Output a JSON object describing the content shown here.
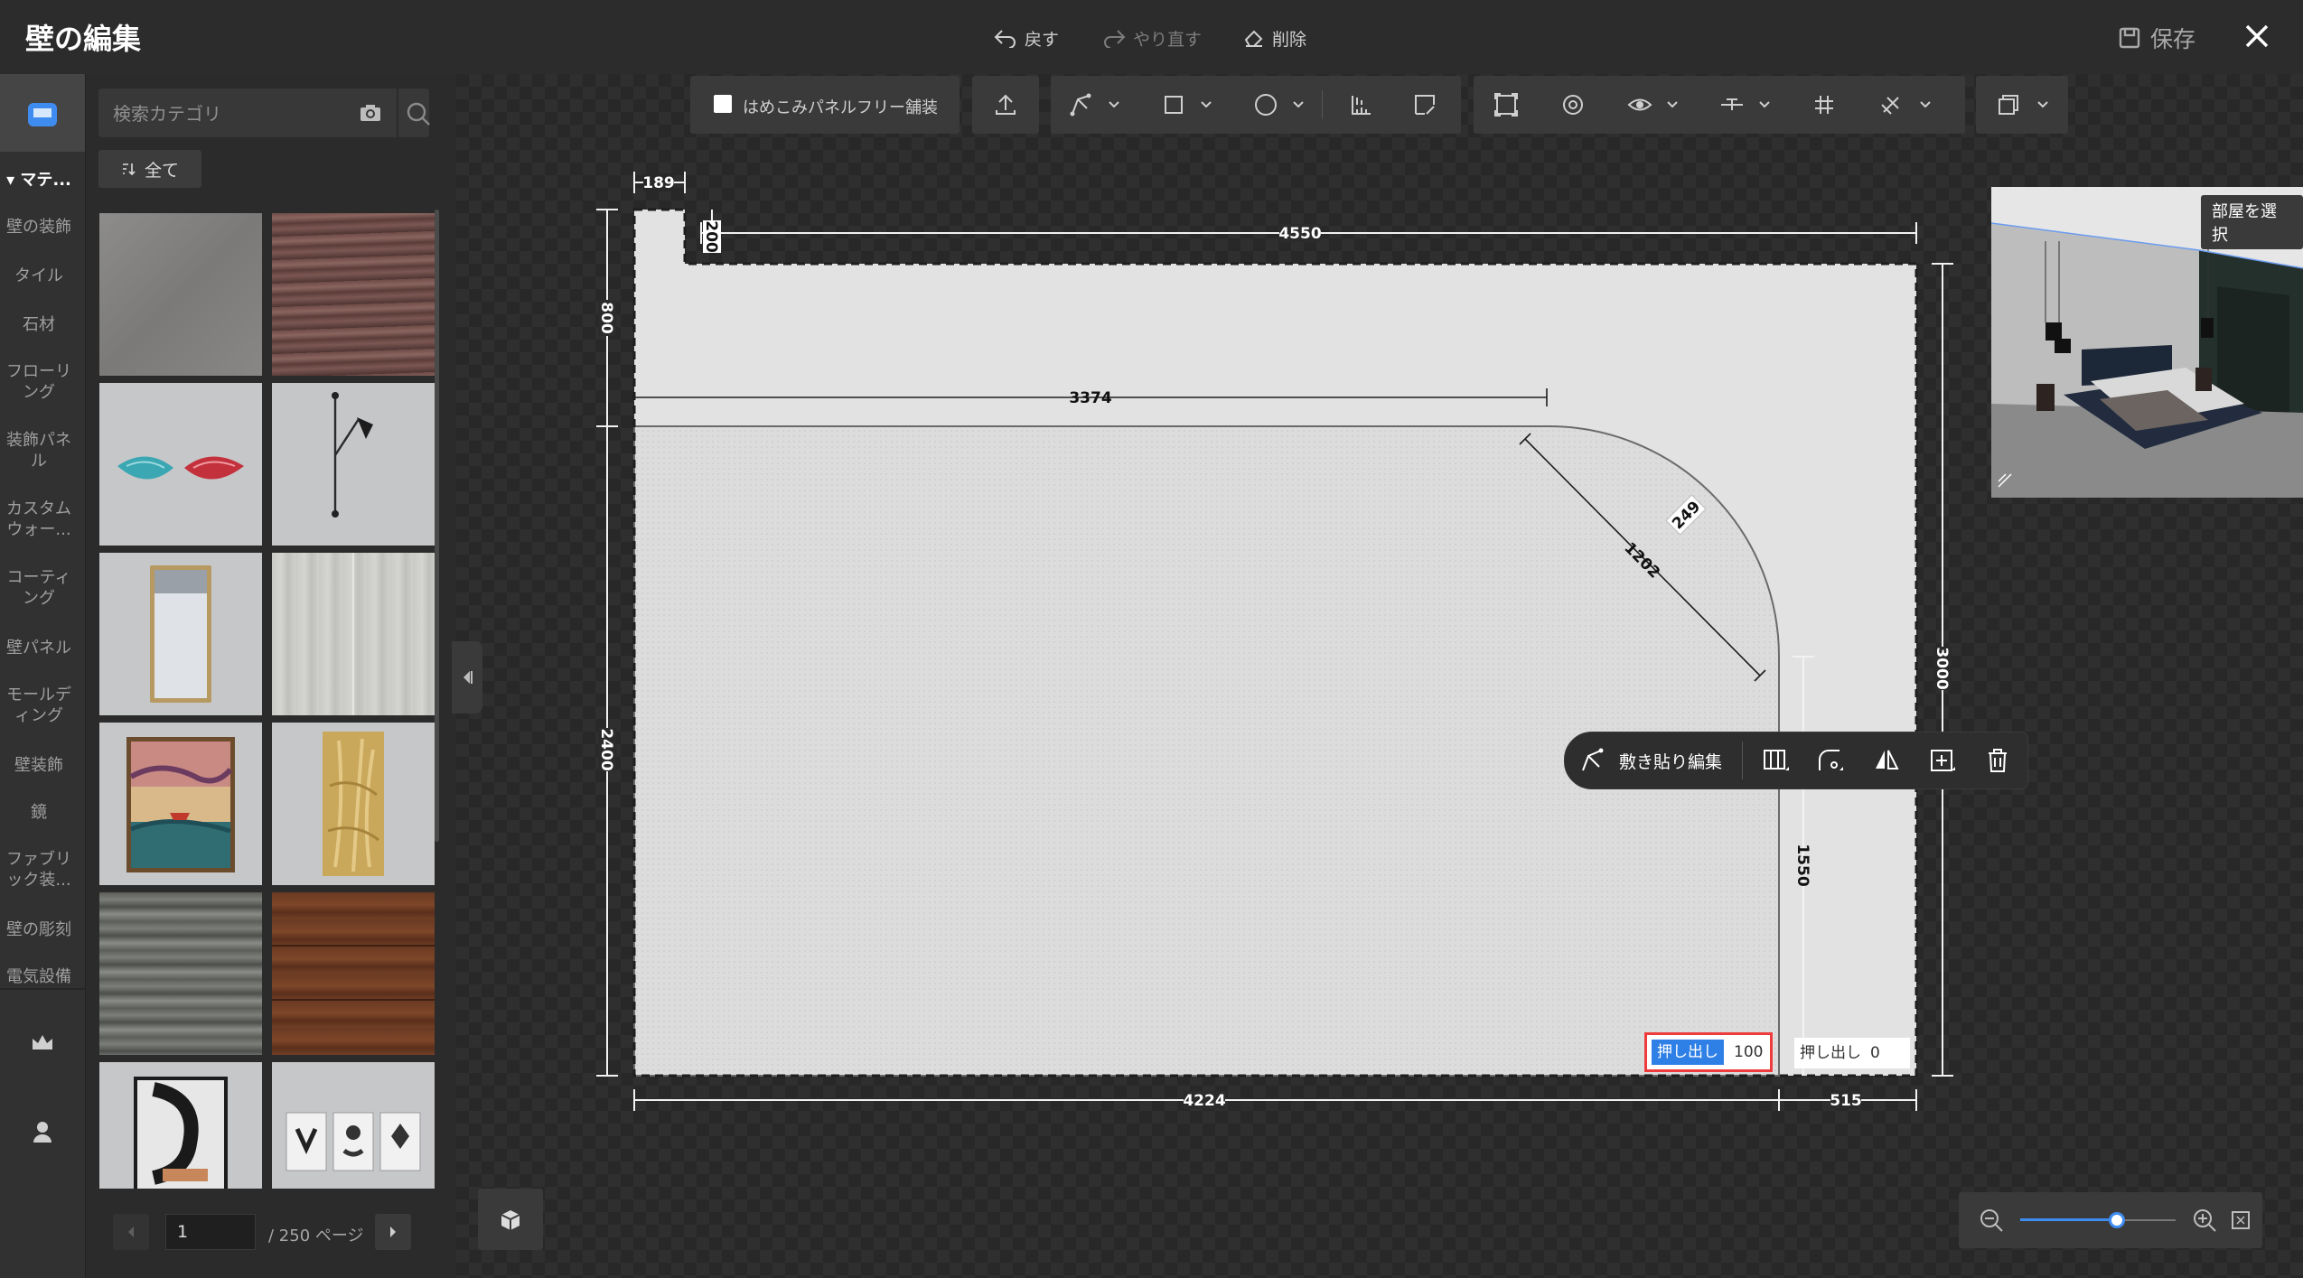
{
  "header": {
    "title": "壁の編集",
    "undo_label": "戻す",
    "redo_label": "やり直す",
    "delete_label": "削除",
    "save_label": "保存"
  },
  "sidebar": {
    "items": [
      {
        "label": "▾ マテ..."
      },
      {
        "label": "壁の装飾"
      },
      {
        "label": "タイル"
      },
      {
        "label": "石材"
      },
      {
        "label": "フローリ\nング"
      },
      {
        "label": "装飾パネ\nル"
      },
      {
        "label": "カスタム\nウォー..."
      },
      {
        "label": "コーティ\nング"
      },
      {
        "label": "壁パネル"
      },
      {
        "label": "モールデ\nィング"
      },
      {
        "label": "壁装飾"
      },
      {
        "label": "鏡"
      },
      {
        "label": "ファブリ\nック装..."
      },
      {
        "label": "壁の彫刻"
      },
      {
        "label": "電気設備"
      }
    ]
  },
  "catalog": {
    "search_placeholder": "検索カテゴリ",
    "all_label": "全て",
    "page_value": "1",
    "page_total": "/ 250 ページ",
    "thumbnails": [
      {
        "name": "concrete-gray"
      },
      {
        "name": "stone-brown"
      },
      {
        "name": "fan-decor"
      },
      {
        "name": "wall-lamp"
      },
      {
        "name": "wall-mirror"
      },
      {
        "name": "marble-tile"
      },
      {
        "name": "boat-painting"
      },
      {
        "name": "gold-relief"
      },
      {
        "name": "gray-wood-plank"
      },
      {
        "name": "brown-wood-plank"
      },
      {
        "name": "abstract-art"
      },
      {
        "name": "triptych-art"
      }
    ]
  },
  "toolbar": {
    "inlay_checkbox_label": "はめこみパネルフリー舗装",
    "inlay_checked": false
  },
  "preview": {
    "select_room_label": "部屋を選択"
  },
  "context_bar": {
    "tile_edit_label": "敷き貼り編集"
  },
  "dimensions": {
    "d189": "189",
    "d200": "200",
    "d4550": "4550",
    "d800": "800",
    "d3374": "3374",
    "d249": "249",
    "d1202": "1202",
    "d2400": "2400",
    "d3000": "3000",
    "d1550": "1550",
    "d4224": "4224",
    "d515": "515"
  },
  "extrude_left": {
    "label": "押し出し",
    "value": "100"
  },
  "extrude_right": {
    "label": "押し出し",
    "value": "0"
  },
  "zoom": {
    "level": 0.62
  },
  "colors": {
    "accent": "#3f8cf0",
    "highlight_border": "#ef3b3b"
  }
}
